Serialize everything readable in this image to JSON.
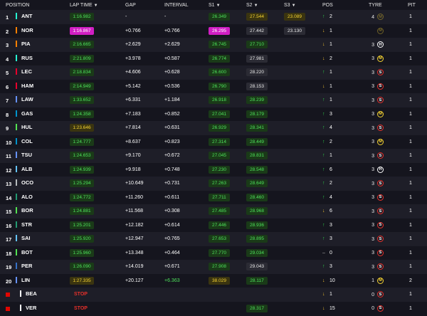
{
  "header": {
    "position": "POSITION",
    "lap_time": "LAP TIME",
    "gap": "GAP",
    "interval": "INTERVAL",
    "s1": "S1",
    "s2": "S2",
    "s3": "S3",
    "pos": "POS",
    "tyre": "TYRE",
    "pit": "PIT"
  },
  "colors": {
    "personal_best": "#4ee35c",
    "overall_best": "#d11ec4",
    "slower": "#f5d332",
    "soft": "#e8302a",
    "medium": "#f5d332",
    "hard": "#ffffff"
  },
  "rows": [
    {
      "pos": "1",
      "driver": "ANT",
      "team_color": "#27f4d2",
      "lap": "1:16.982",
      "lap_c": "g",
      "gap": "-",
      "interval": "-",
      "s1": "26.349",
      "s1_c": "g",
      "s2": "27.544",
      "s2_c": "y",
      "s3": "23.089",
      "s3_c": "y",
      "dir": "up",
      "change": "2",
      "tyre_laps": "4",
      "tyre": "M",
      "pit": "1",
      "tyre_dim": true
    },
    {
      "pos": "2",
      "driver": "NOR",
      "team_color": "#ff8000",
      "lap": "1:16.867",
      "lap_c": "p",
      "gap": "+0.766",
      "interval": "+0.766",
      "s1": "26.295",
      "s1_c": "p",
      "s2": "27.442",
      "s2_c": "n",
      "s3": "23.130",
      "s3_c": "n",
      "dir": "down",
      "change": "1",
      "tyre_laps": "",
      "tyre": "M",
      "pit": "1",
      "tyre_dim": true
    },
    {
      "pos": "3",
      "driver": "PIA",
      "team_color": "#ff8000",
      "lap": "2:16.665",
      "lap_c": "g",
      "gap": "+2.629",
      "interval": "+2.629",
      "s1": "26.745",
      "s1_c": "g",
      "s2": "27.710",
      "s2_c": "g",
      "s3": "",
      "s3_c": "",
      "dir": "down",
      "change": "1",
      "tyre_laps": "3",
      "tyre": "H",
      "pit": "1"
    },
    {
      "pos": "4",
      "driver": "RUS",
      "team_color": "#27f4d2",
      "lap": "2:21.809",
      "lap_c": "g",
      "gap": "+3.978",
      "interval": "+0.587",
      "s1": "26.774",
      "s1_c": "g",
      "s2": "27.981",
      "s2_c": "n",
      "s3": "",
      "s3_c": "",
      "dir": "down",
      "change": "2",
      "tyre_laps": "3",
      "tyre": "M",
      "pit": "1"
    },
    {
      "pos": "5",
      "driver": "LEC",
      "team_color": "#e8002d",
      "lap": "2:18.834",
      "lap_c": "g",
      "gap": "+4.606",
      "interval": "+0.628",
      "s1": "26.600",
      "s1_c": "g",
      "s2": "28.220",
      "s2_c": "n",
      "s3": "",
      "s3_c": "",
      "dir": "up",
      "change": "1",
      "tyre_laps": "3",
      "tyre": "S",
      "pit": "1"
    },
    {
      "pos": "6",
      "driver": "HAM",
      "team_color": "#e8002d",
      "lap": "2:14.949",
      "lap_c": "g",
      "gap": "+5.142",
      "interval": "+0.536",
      "s1": "26.790",
      "s1_c": "g",
      "s2": "28.153",
      "s2_c": "n",
      "s3": "",
      "s3_c": "",
      "dir": "down",
      "change": "1",
      "tyre_laps": "3",
      "tyre": "S",
      "pit": "1"
    },
    {
      "pos": "7",
      "driver": "LAW",
      "team_color": "#6692ff",
      "lap": "1:33.652",
      "lap_c": "g",
      "gap": "+6.331",
      "interval": "+1.184",
      "s1": "26.918",
      "s1_c": "g",
      "s2": "28.239",
      "s2_c": "g",
      "s3": "",
      "s3_c": "",
      "dir": "up",
      "change": "1",
      "tyre_laps": "3",
      "tyre": "S",
      "pit": "1"
    },
    {
      "pos": "8",
      "driver": "GAS",
      "team_color": "#0093cc",
      "lap": "1:24.358",
      "lap_c": "g",
      "gap": "+7.183",
      "interval": "+0.852",
      "s1": "27.041",
      "s1_c": "g",
      "s2": "28.179",
      "s2_c": "g",
      "s3": "",
      "s3_c": "",
      "dir": "up",
      "change": "3",
      "tyre_laps": "3",
      "tyre": "M",
      "pit": "1"
    },
    {
      "pos": "9",
      "driver": "HUL",
      "team_color": "#52e252",
      "lap": "1:23.646",
      "lap_c": "y",
      "gap": "+7.814",
      "interval": "+0.631",
      "s1": "26.929",
      "s1_c": "g",
      "s2": "28.341",
      "s2_c": "g",
      "s3": "",
      "s3_c": "",
      "dir": "up",
      "change": "4",
      "tyre_laps": "3",
      "tyre": "S",
      "pit": "1"
    },
    {
      "pos": "10",
      "driver": "COL",
      "team_color": "#0093cc",
      "lap": "1:24.777",
      "lap_c": "g",
      "gap": "+8.637",
      "interval": "+0.823",
      "s1": "27.314",
      "s1_c": "g",
      "s2": "28.449",
      "s2_c": "g",
      "s3": "",
      "s3_c": "",
      "dir": "up",
      "change": "2",
      "tyre_laps": "3",
      "tyre": "M",
      "pit": "1"
    },
    {
      "pos": "11",
      "driver": "TSU",
      "team_color": "#6692ff",
      "lap": "1:24.653",
      "lap_c": "g",
      "gap": "+9.170",
      "interval": "+0.672",
      "s1": "27.045",
      "s1_c": "g",
      "s2": "28.831",
      "s2_c": "g",
      "s3": "",
      "s3_c": "",
      "dir": "up",
      "change": "1",
      "tyre_laps": "3",
      "tyre": "S",
      "pit": "1"
    },
    {
      "pos": "12",
      "driver": "ALB",
      "team_color": "#64c4ff",
      "lap": "1:24.939",
      "lap_c": "g",
      "gap": "+9.918",
      "interval": "+0.748",
      "s1": "27.230",
      "s1_c": "g",
      "s2": "28.548",
      "s2_c": "g",
      "s3": "",
      "s3_c": "",
      "dir": "up",
      "change": "6",
      "tyre_laps": "3",
      "tyre": "H",
      "pit": "1"
    },
    {
      "pos": "13",
      "driver": "OCO",
      "team_color": "#b6babd",
      "lap": "1:25.294",
      "lap_c": "g",
      "gap": "+10.649",
      "interval": "+0.731",
      "s1": "27.263",
      "s1_c": "g",
      "s2": "28.649",
      "s2_c": "g",
      "s3": "",
      "s3_c": "",
      "dir": "up",
      "change": "2",
      "tyre_laps": "3",
      "tyre": "S",
      "pit": "1"
    },
    {
      "pos": "14",
      "driver": "ALO",
      "team_color": "#229971",
      "lap": "1:24.772",
      "lap_c": "g",
      "gap": "+11.260",
      "interval": "+0.611",
      "s1": "27.711",
      "s1_c": "g",
      "s2": "28.460",
      "s2_c": "g",
      "s3": "",
      "s3_c": "",
      "dir": "up",
      "change": "4",
      "tyre_laps": "3",
      "tyre": "S",
      "pit": "1"
    },
    {
      "pos": "15",
      "driver": "BOR",
      "team_color": "#52e252",
      "lap": "1:24.881",
      "lap_c": "g",
      "gap": "+11.568",
      "interval": "+0.308",
      "s1": "27.485",
      "s1_c": "g",
      "s2": "28.968",
      "s2_c": "g",
      "s3": "",
      "s3_c": "",
      "dir": "down",
      "change": "6",
      "tyre_laps": "3",
      "tyre": "S",
      "pit": "1"
    },
    {
      "pos": "16",
      "driver": "STR",
      "team_color": "#229971",
      "lap": "1:25.201",
      "lap_c": "g",
      "gap": "+12.182",
      "interval": "+0.614",
      "s1": "27.446",
      "s1_c": "g",
      "s2": "28.936",
      "s2_c": "g",
      "s3": "",
      "s3_c": "",
      "dir": "up",
      "change": "3",
      "tyre_laps": "3",
      "tyre": "S",
      "pit": "1"
    },
    {
      "pos": "17",
      "driver": "SAI",
      "team_color": "#64c4ff",
      "lap": "1:25.920",
      "lap_c": "g",
      "gap": "+12.947",
      "interval": "+0.765",
      "s1": "27.653",
      "s1_c": "g",
      "s2": "28.895",
      "s2_c": "g",
      "s3": "",
      "s3_c": "",
      "dir": "up",
      "change": "3",
      "tyre_laps": "3",
      "tyre": "S",
      "pit": "1"
    },
    {
      "pos": "18",
      "driver": "BOT",
      "team_color": "#52e252",
      "lap": "1:25.960",
      "lap_c": "g",
      "gap": "+13.348",
      "interval": "+0.464",
      "s1": "27.770",
      "s1_c": "g",
      "s2": "29.034",
      "s2_c": "g",
      "s3": "",
      "s3_c": "",
      "dir": "none",
      "change": "0",
      "tyre_laps": "3",
      "tyre": "S",
      "pit": "1"
    },
    {
      "pos": "19",
      "driver": "PER",
      "team_color": "#3671c6",
      "lap": "1:26.090",
      "lap_c": "g",
      "gap": "+14.019",
      "interval": "+0.671",
      "s1": "27.908",
      "s1_c": "g",
      "s2": "29.043",
      "s2_c": "n",
      "s3": "",
      "s3_c": "",
      "dir": "up",
      "change": "3",
      "tyre_laps": "3",
      "tyre": "S",
      "pit": "1"
    },
    {
      "pos": "20",
      "driver": "LIN",
      "team_color": "#6692ff",
      "lap": "1:27.335",
      "lap_c": "y",
      "gap": "+20.127",
      "interval": "+6.363",
      "interval_green": true,
      "s1": "38.029",
      "s1_c": "y",
      "s2": "28.117",
      "s2_c": "g",
      "s3": "",
      "s3_c": "",
      "dir": "down",
      "change": "10",
      "tyre_laps": "1",
      "tyre": "M",
      "pit": "2"
    },
    {
      "pos": "",
      "driver": "BEA",
      "team_color": "#ffffff",
      "stop": true,
      "lap": "STOP",
      "lap_c": "",
      "gap": "",
      "interval": "",
      "s1": "",
      "s1_c": "",
      "s2": "",
      "s2_c": "",
      "s3": "",
      "s3_c": "",
      "dir": "down",
      "change": "1",
      "tyre_laps": "0",
      "tyre": "S",
      "pit": "1"
    },
    {
      "pos": "",
      "driver": "VER",
      "team_color": "#ffffff",
      "stop": true,
      "lap": "STOP",
      "lap_c": "",
      "gap": "",
      "interval": "",
      "s1": "",
      "s1_c": "",
      "s2": "28.317",
      "s2_c": "g",
      "s3": "",
      "s3_c": "",
      "dir": "down",
      "change": "15",
      "tyre_laps": "0",
      "tyre": "S",
      "pit": "1"
    }
  ]
}
